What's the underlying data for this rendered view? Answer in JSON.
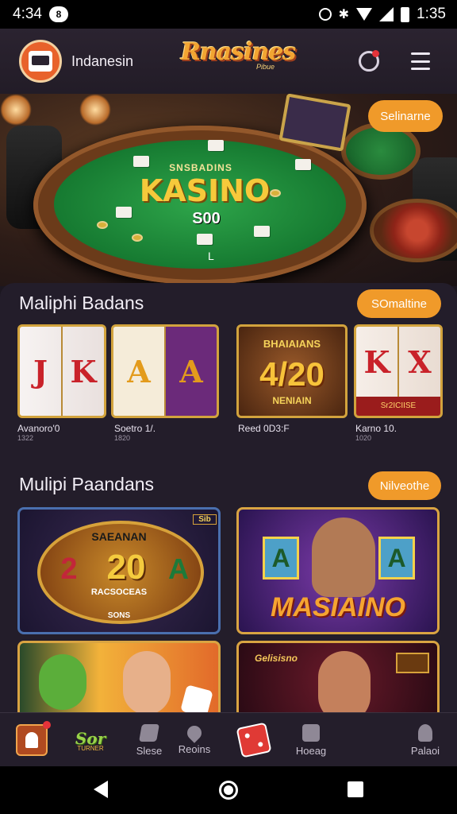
{
  "status_bar": {
    "time_left": "4:34",
    "notif_badge": "8",
    "time_right": "1:35"
  },
  "header": {
    "region": "Indanesin",
    "brand": "Rnasines",
    "brand_sub": "Pibue"
  },
  "hero": {
    "felt_sub": "SNSBADINS",
    "felt_title": "KASINO",
    "felt_amount": "S00",
    "felt_mark": "L",
    "badge": "Selinarne"
  },
  "section1": {
    "title": "Maliphi Badans",
    "button": "SOmaltine",
    "slots": [
      {
        "reels": [
          "J",
          "K"
        ],
        "caption": "Avanoro'0",
        "sub": "1322"
      },
      {
        "reels": [
          "A",
          "A"
        ],
        "caption": "Soetro 1/.",
        "sub": "1820"
      },
      {
        "top": "BHAIAIANS",
        "center": "4/20",
        "bottom": "NENIAIN",
        "caption": "Reed 0D3:F",
        "sub": ""
      },
      {
        "reels": [
          "K",
          "X"
        ],
        "caption": "Karno 10.",
        "sub": "1020",
        "banner": "Sr2ICIISE"
      }
    ]
  },
  "section2": {
    "title": "Mulipi Paandans",
    "button": "Nilveothe",
    "cards": [
      {
        "top": "SAEANAN",
        "center": "20",
        "left_digit": "2",
        "right_letter": "A",
        "bottom": "RACSOCEAS",
        "footer": "SONS",
        "tag": "Sib"
      },
      {
        "left_letter": "A",
        "right_letter": "A",
        "title": "MASIAINO"
      },
      {
        "tag": ""
      },
      {
        "label": "Gelisisno",
        "tag": ""
      }
    ]
  },
  "bottom_nav": [
    {
      "label": ""
    },
    {
      "label": "Sor",
      "sub": "TURNER"
    },
    {
      "label": "Slese"
    },
    {
      "label": "Reoins"
    },
    {
      "label": ""
    },
    {
      "label": "Hoeag"
    },
    {
      "label": "Palaoi"
    }
  ]
}
